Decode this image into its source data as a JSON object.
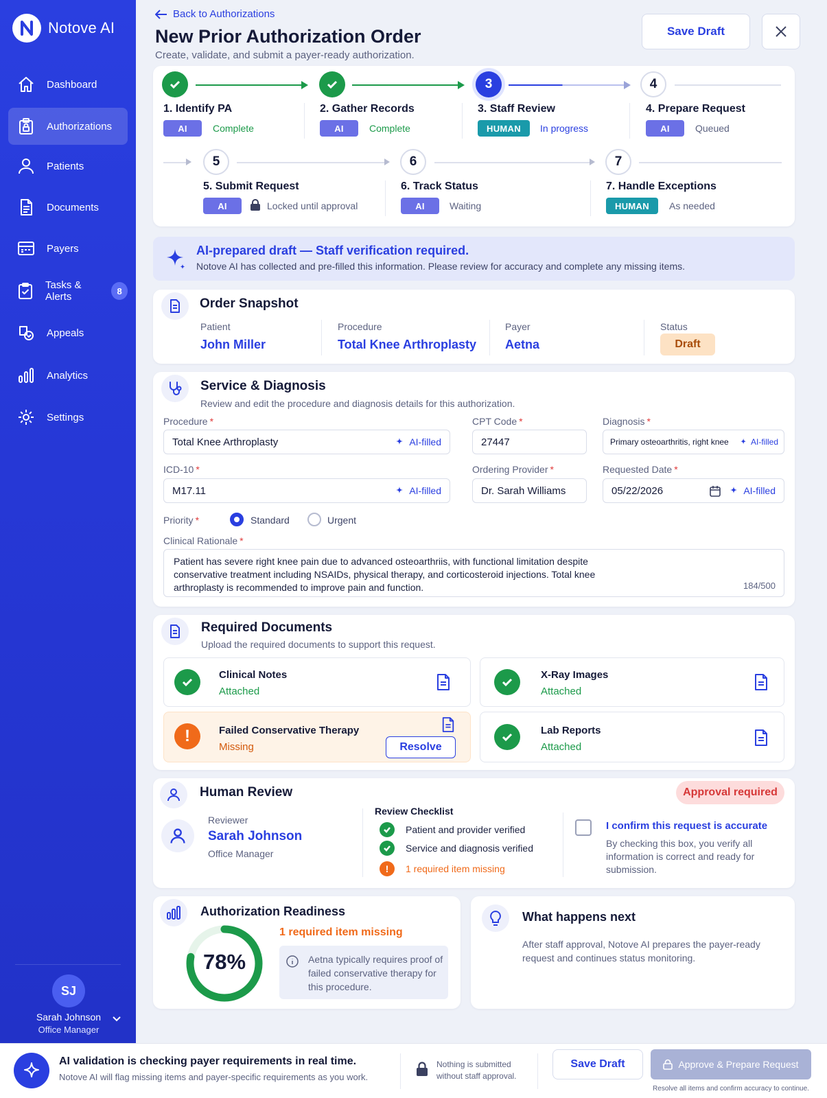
{
  "brand": {
    "name": "Notove AI"
  },
  "nav": [
    {
      "label": "Dashboard",
      "icon": "home-icon"
    },
    {
      "label": "Authorizations",
      "icon": "clipboard-lock-icon",
      "active": true
    },
    {
      "label": "Patients",
      "icon": "user-icon"
    },
    {
      "label": "Documents",
      "icon": "document-icon"
    },
    {
      "label": "Payers",
      "icon": "card-icon"
    },
    {
      "label": "Tasks & Alerts",
      "icon": "task-icon",
      "badge": "8"
    },
    {
      "label": "Appeals",
      "icon": "appeal-icon"
    },
    {
      "label": "Analytics",
      "icon": "analytics-icon"
    },
    {
      "label": "Settings",
      "icon": "gear-icon"
    }
  ],
  "user": {
    "initials": "SJ",
    "name": "Sarah Johnson",
    "role": "Office Manager"
  },
  "header": {
    "back": "Back to Authorizations",
    "title": "New Prior Authorization Order",
    "subtitle": "Create, validate, and submit a payer-ready authorization.",
    "save_draft": "Save Draft"
  },
  "steps": [
    {
      "num": "1",
      "title": "1. Identify PA",
      "tag": "AI",
      "status": "Complete",
      "state": "done"
    },
    {
      "num": "2",
      "title": "2. Gather Records",
      "tag": "AI",
      "status": "Complete",
      "state": "done"
    },
    {
      "num": "3",
      "title": "3. Staff Review",
      "tag": "HUMAN",
      "status": "In progress",
      "state": "current"
    },
    {
      "num": "4",
      "title": "4. Prepare Request",
      "tag": "AI",
      "status": "Queued",
      "state": "next"
    },
    {
      "num": "5",
      "title": "5. Submit Request",
      "tag": "AI",
      "status": "Locked until approval",
      "state": "next"
    },
    {
      "num": "6",
      "title": "6. Track Status",
      "tag": "AI",
      "status": "Waiting",
      "state": "next"
    },
    {
      "num": "7",
      "title": "7. Handle Exceptions",
      "tag": "HUMAN",
      "status": "As needed",
      "state": "next"
    }
  ],
  "banner": {
    "title": "AI-prepared draft — Staff verification required.",
    "text": "Notove AI has collected and pre-filled this information. Please review for accuracy and complete any missing items."
  },
  "snapshot": {
    "title": "Order Snapshot",
    "patient_label": "Patient",
    "patient": "John Miller",
    "procedure_label": "Procedure",
    "procedure": "Total Knee Arthroplasty",
    "payer_label": "Payer",
    "payer": "Aetna",
    "status_label": "Status",
    "status": "Draft"
  },
  "service": {
    "title": "Service & Diagnosis",
    "subtitle": "Review and edit the procedure and diagnosis details for this authorization.",
    "procedure_label": "Procedure",
    "procedure": "Total Knee Arthroplasty",
    "cpt_label": "CPT Code",
    "cpt": "27447",
    "diagnosis_label": "Diagnosis",
    "diagnosis": "Primary osteoarthritis, right knee",
    "icd_label": "ICD-10",
    "icd": "M17.11",
    "provider_label": "Ordering Provider",
    "provider": "Dr. Sarah Williams",
    "date_label": "Requested Date",
    "date": "05/22/2026",
    "ai_filled": "AI-filled",
    "priority_label": "Priority",
    "priority_standard": "Standard",
    "priority_urgent": "Urgent",
    "rationale_label": "Clinical Rationale",
    "rationale_l1": "Patient has severe right knee pain due to advanced osteoarthriis, with functional limitation despite",
    "rationale_l2": "conservative treatment including NSAIDs, physical therapy, and corticosteroid injections. Total knee",
    "rationale_l3": "arthroplasty is recommended to improve pain and function.",
    "char_count": "184/500"
  },
  "documents": {
    "title": "Required Documents",
    "subtitle": "Upload the required documents to support this request.",
    "items": [
      {
        "name": "Clinical Notes",
        "status": "Attached"
      },
      {
        "name": "X-Ray Images",
        "status": "Attached"
      },
      {
        "name": "Failed Conservative Therapy",
        "status": "Missing",
        "action": "Resolve"
      },
      {
        "name": "Lab Reports",
        "status": "Attached"
      }
    ]
  },
  "review": {
    "title": "Human Review",
    "badge": "Approval required",
    "reviewer_label": "Reviewer",
    "reviewer": "Sarah Johnson",
    "reviewer_role": "Office Manager",
    "checklist_title": "Review Checklist",
    "checklist": [
      "Patient and provider verified",
      "Service and diagnosis verified",
      "1 required item missing"
    ],
    "confirm_title": "I confirm this request is accurate",
    "confirm_l1": "By checking this box, you verify all",
    "confirm_l2": "information is correct and ready for",
    "confirm_l3": "submission."
  },
  "readiness": {
    "title": "Authorization Readiness",
    "percent": "78%",
    "value": 0.78,
    "missing": "1 required item missing",
    "info_l1": "Aetna typically requires proof of",
    "info_l2": "failed conservative therapy for",
    "info_l3": "this procedure."
  },
  "next": {
    "title": "What happens next",
    "l1": "After staff approval, Notove AI prepares the payer-ready",
    "l2": "request and continues status monitoring."
  },
  "footer": {
    "title": "AI validation is checking payer requirements in real time.",
    "text": "Notove AI will flag missing items and payer-specific requirements as you work.",
    "lock_l1": "Nothing is submitted",
    "lock_l2": "without staff approval.",
    "save_draft": "Save Draft",
    "approve": "Approve & Prepare Request",
    "hint": "Resolve all items and confirm accuracy to continue."
  },
  "colors": {
    "brand": "#2a3fe0",
    "success": "#1c9a4a",
    "warning": "#f06a1a",
    "danger": "#e03a3a",
    "human": "#1a9aaa",
    "ai": "#6b70e6"
  }
}
